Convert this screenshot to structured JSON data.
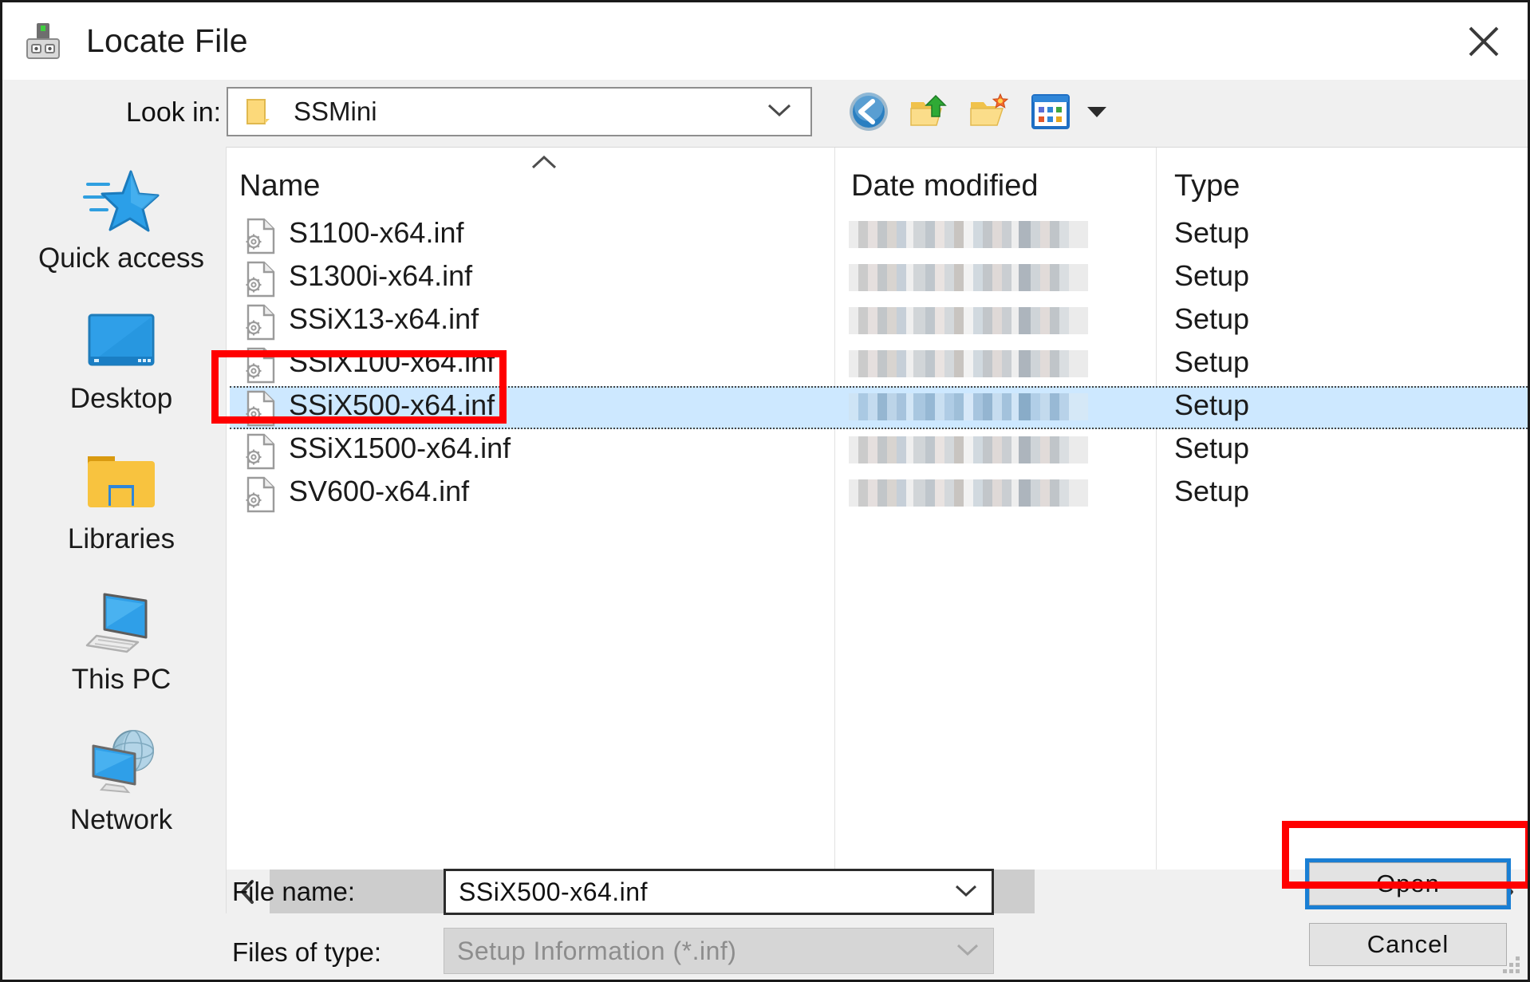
{
  "window": {
    "title": "Locate File",
    "title_icon": "printer-device-icon",
    "close_label": "close-icon"
  },
  "lookin": {
    "label": "Look in:",
    "value": "SSMini",
    "folder_icon": "folder-icon",
    "chevron_icon": "chevron-down-icon"
  },
  "toolbar": {
    "buttons": [
      {
        "name": "back-button",
        "icon": "back-arrow-icon"
      },
      {
        "name": "up-one-level-button",
        "icon": "up-folder-icon"
      },
      {
        "name": "new-folder-button",
        "icon": "new-folder-icon"
      },
      {
        "name": "views-button",
        "icon": "views-grid-icon"
      },
      {
        "name": "views-dropdown-button",
        "icon": "caret-down-icon"
      }
    ]
  },
  "places": [
    {
      "label": "Quick access",
      "icon": "quick-access-star-icon"
    },
    {
      "label": "Desktop",
      "icon": "desktop-monitor-icon"
    },
    {
      "label": "Libraries",
      "icon": "libraries-folder-icon"
    },
    {
      "label": "This PC",
      "icon": "this-pc-icon"
    },
    {
      "label": "Network",
      "icon": "network-globe-icon"
    }
  ],
  "filelist": {
    "columns": [
      {
        "key": "name",
        "label": "Name",
        "sorted": "ascending"
      },
      {
        "key": "date",
        "label": "Date modified"
      },
      {
        "key": "type",
        "label": "Type"
      }
    ],
    "sort_indicator_icon": "sort-ascending-chevron-icon",
    "rows": [
      {
        "name": "S1100-x64.inf",
        "date": "",
        "type": "Setup",
        "icon": "inf-file-icon",
        "selected": false
      },
      {
        "name": "S1300i-x64.inf",
        "date": "",
        "type": "Setup",
        "icon": "inf-file-icon",
        "selected": false
      },
      {
        "name": "SSiX13-x64.inf",
        "date": "",
        "type": "Setup",
        "icon": "inf-file-icon",
        "selected": false
      },
      {
        "name": "SSiX100-x64.inf",
        "date": "",
        "type": "Setup",
        "icon": "inf-file-icon",
        "selected": false
      },
      {
        "name": "SSiX500-x64.inf",
        "date": "",
        "type": "Setup",
        "icon": "inf-file-icon",
        "selected": true
      },
      {
        "name": "SSiX1500-x64.inf",
        "date": "",
        "type": "Setup",
        "icon": "inf-file-icon",
        "selected": false
      },
      {
        "name": "SV600-x64.inf",
        "date": "",
        "type": "Setup",
        "icon": "inf-file-icon",
        "selected": false
      }
    ]
  },
  "scrollbar": {
    "left_arrow_icon": "chevron-left-icon",
    "right_arrow_icon": "chevron-right-icon"
  },
  "bottom": {
    "filename_label": "File name:",
    "filename_value": "SSiX500-x64.inf",
    "filetype_label": "Files of type:",
    "filetype_value": "Setup Information (*.inf)",
    "open_label": "Open",
    "cancel_label": "Cancel",
    "chevron_icon": "chevron-down-icon"
  },
  "annotations": {
    "accent_color": "#ff0000",
    "focus_color": "#1a7fd4",
    "selection_color": "#cde8ff",
    "boxes": [
      {
        "name": "annotation-box-selected-file"
      },
      {
        "name": "annotation-box-open-button"
      }
    ]
  }
}
